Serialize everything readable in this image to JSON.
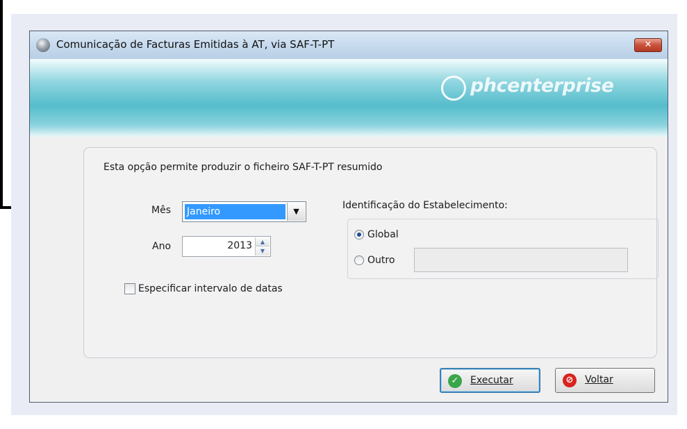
{
  "window": {
    "title": "Comunicação de Facturas Emitidas à AT, via SAF-T-PT",
    "close_label": "✕"
  },
  "banner": {
    "logo_text": "phcenterprise"
  },
  "form": {
    "description": "Esta opção permite produzir o ficheiro SAF-T-PT resumido",
    "mes_label": "Mês",
    "mes_value": "Janeiro",
    "ano_label": "Ano",
    "ano_value": "2013",
    "interval_label": "Especificar intervalo de datas",
    "interval_checked": false
  },
  "establishment": {
    "title": "Identificação do Estabelecimento:",
    "options": [
      {
        "label": "Global",
        "checked": true
      },
      {
        "label": "Outro",
        "checked": false
      }
    ],
    "outro_value": ""
  },
  "buttons": {
    "execute_label": "Executar",
    "back_label": "Voltar"
  },
  "colors": {
    "selection": "#3399ff",
    "banner_teal": "#55bccc",
    "execute_icon": "#3aa64a",
    "back_icon": "#d8231f"
  }
}
